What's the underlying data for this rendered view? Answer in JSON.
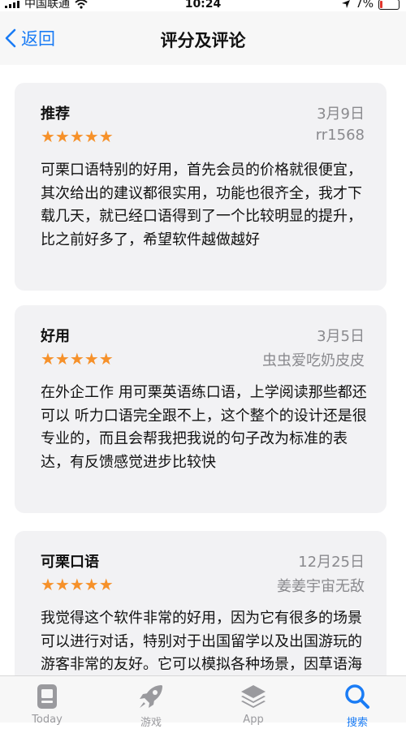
{
  "status_bar": {
    "carrier": "中国联通",
    "time": "10:24",
    "battery": "7%"
  },
  "nav": {
    "back_label": "返回",
    "title": "评分及评论"
  },
  "reviews": [
    {
      "title": "推荐",
      "date": "3月9日",
      "stars": "★★★★★",
      "author": "rr1568",
      "body": "可栗口语特别的好用，首先会员的价格就很便宜，其次给出的建议都很实用，功能也很齐全，我才下载几天，就已经口语得到了一个比较明显的提升，比之前好多了，希望软件越做越好"
    },
    {
      "title": "好用",
      "date": "3月5日",
      "stars": "★★★★★",
      "author": "虫虫爱吃奶皮皮",
      "body": "在外企工作 用可栗英语练口语，上学阅读那些都还可以 听力口语完全跟不上，这个整个的设计还是很专业的，而且会帮我把我说的句子改为标准的表达，有反馈感觉进步比较快"
    },
    {
      "title": "可栗口语",
      "date": "12月25日",
      "stars": "★★★★★",
      "author": "姜姜宇宙无敌",
      "body": "我觉得这个软件非常的好用，因为它有很多的场景可以进行对话，特别对于出国留学以及出国游玩的游客非常的友好。它可以模拟各种场景，因草语海话就更会突快张"
    }
  ],
  "tabs": [
    {
      "label": "Today",
      "icon": "today-icon"
    },
    {
      "label": "游戏",
      "icon": "rocket-icon"
    },
    {
      "label": "App",
      "icon": "layers-icon"
    },
    {
      "label": "搜索",
      "icon": "search-icon"
    }
  ],
  "colors": {
    "accent": "#1a7cf5",
    "stars": "#f6912a",
    "card": "#f2f2f4"
  }
}
